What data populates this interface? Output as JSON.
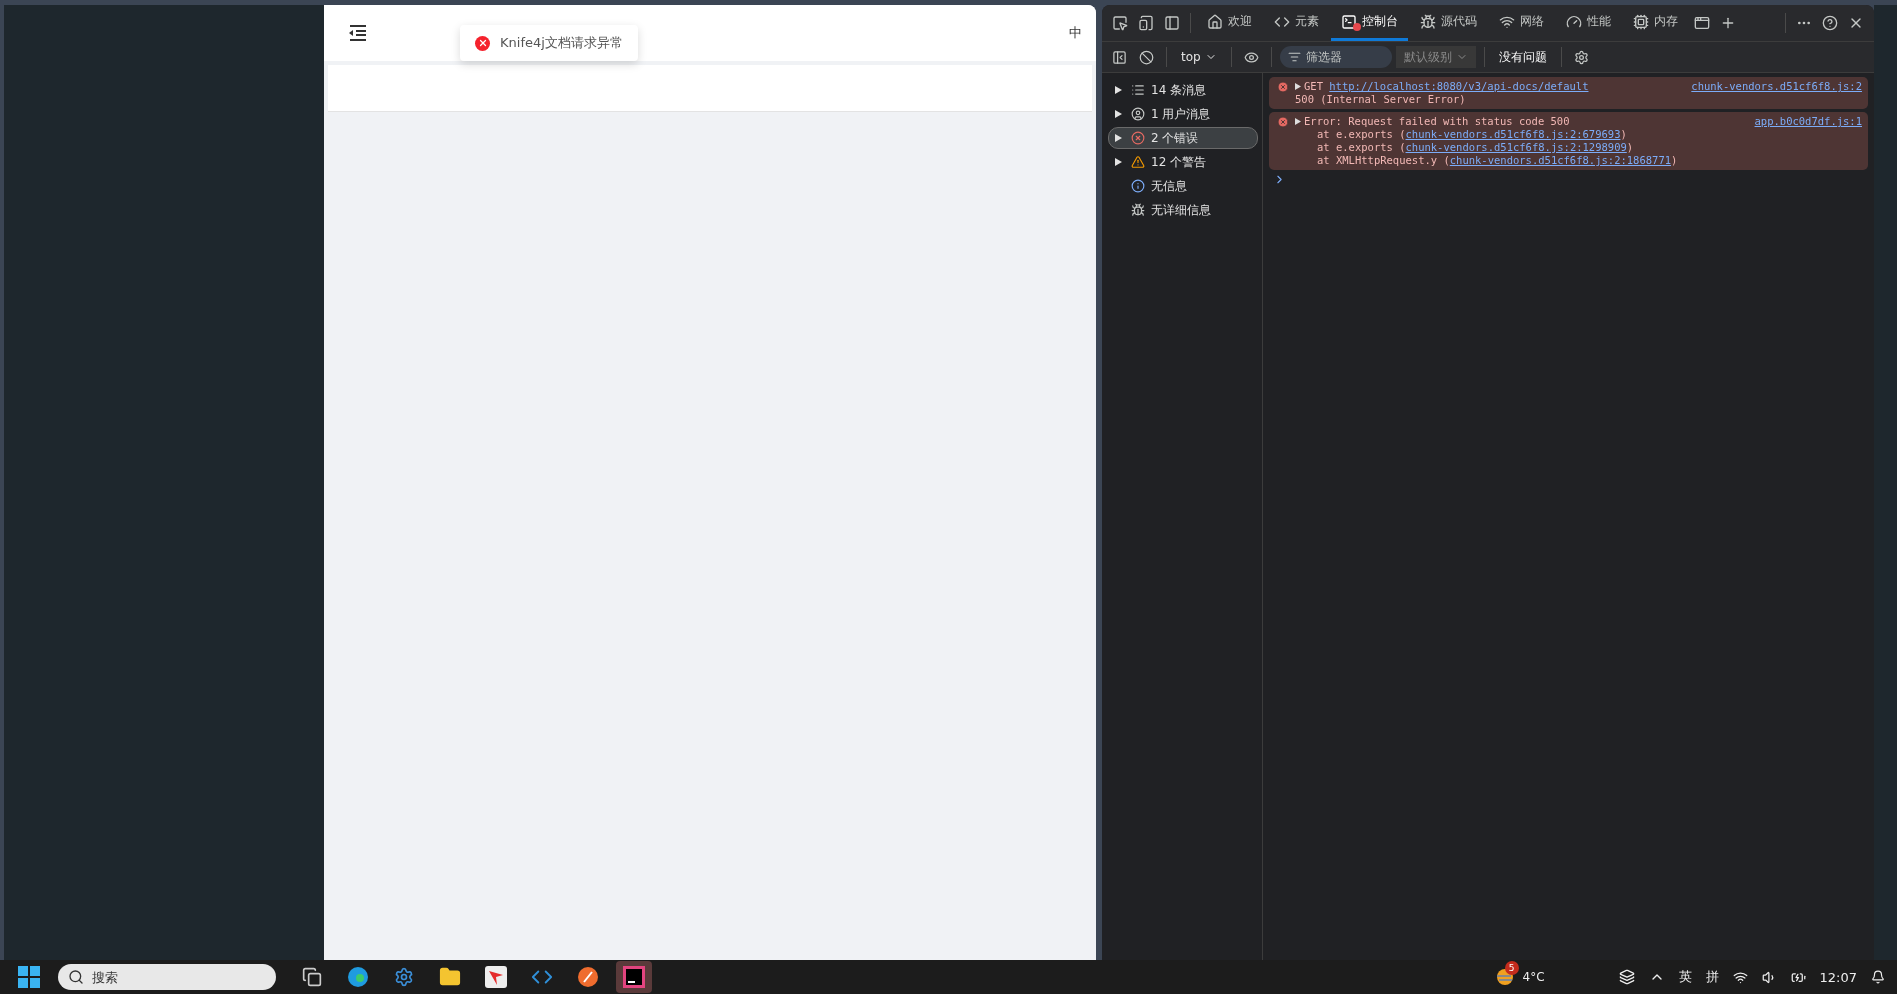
{
  "page": {
    "toast": {
      "text": "Knife4j文档请求异常"
    },
    "language": "中"
  },
  "devtools": {
    "tabs": [
      {
        "label": "欢迎",
        "selected": false
      },
      {
        "label": "元素",
        "selected": false
      },
      {
        "label": "控制台",
        "selected": true,
        "error_badge": true
      },
      {
        "label": "源代码",
        "selected": false
      },
      {
        "label": "网络",
        "selected": false
      },
      {
        "label": "性能",
        "selected": false
      },
      {
        "label": "内存",
        "selected": false
      }
    ],
    "toolbar": {
      "context": "top",
      "filter": {
        "placeholder": "筛选器"
      },
      "level": "默认级别",
      "issues": "没有问题"
    },
    "sidebar": [
      {
        "label": "14 条消息",
        "expandable": true,
        "selected": false
      },
      {
        "label": "1 用户消息",
        "expandable": true,
        "selected": false
      },
      {
        "label": "2 个错误",
        "expandable": true,
        "selected": true
      },
      {
        "label": "12 个警告",
        "expandable": true,
        "selected": false
      },
      {
        "label": "无信息",
        "expandable": false,
        "selected": false
      },
      {
        "label": "无详细信息",
        "expandable": false,
        "selected": false
      }
    ],
    "messages": [
      {
        "method": "GET",
        "url": "http://localhost:8080/v3/api-docs/default",
        "source": "chunk-vendors.d51cf6f8.js:2",
        "detail": "500 (Internal Server Error)"
      },
      {
        "text": "Error: Request failed with status code 500",
        "source": "app.b0c0d7df.js:1",
        "stack": [
          {
            "prefix": "at e.exports (",
            "link": "chunk-vendors.d51cf6f8.js:2:679693",
            "suffix": ")"
          },
          {
            "prefix": "at e.exports (",
            "link": "chunk-vendors.d51cf6f8.js:2:1298909",
            "suffix": ")"
          },
          {
            "prefix": "at XMLHttpRequest.y (",
            "link": "chunk-vendors.d51cf6f8.js:2:1868771",
            "suffix": ")"
          }
        ]
      }
    ]
  },
  "taskbar": {
    "search": {
      "placeholder": "搜索"
    },
    "apps": [
      {
        "selected": false
      },
      {
        "selected": false
      },
      {
        "selected": false
      },
      {
        "selected": false
      },
      {
        "selected": false
      },
      {
        "selected": false
      },
      {
        "selected": false
      },
      {
        "selected": true
      }
    ],
    "weather": {
      "badge": "5",
      "temperature": "4°C"
    },
    "input_mode": "英",
    "ime": "拼",
    "time": "12:07"
  }
}
